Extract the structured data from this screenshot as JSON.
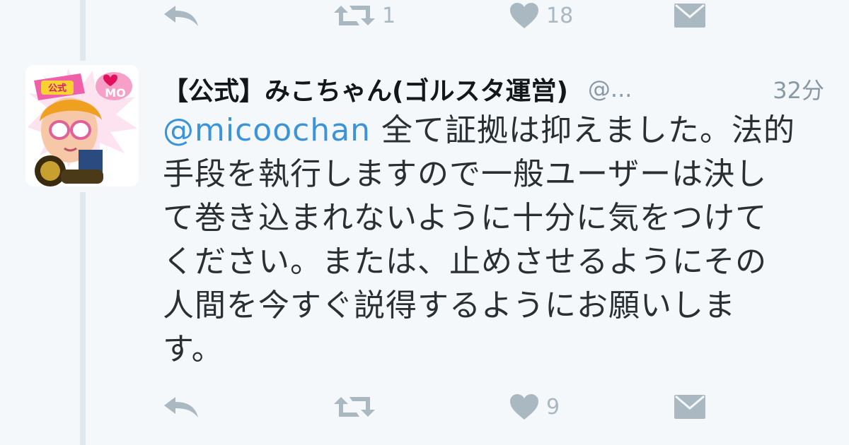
{
  "previous_tweet": {
    "retweet_count": "1",
    "like_count": "18"
  },
  "tweet": {
    "display_name": "【公式】みこちゃん(ゴルスタ運営)",
    "handle": "@...",
    "timestamp": "32分",
    "mention": "@micoochan",
    "text_lines": [
      " 全て証拠は抑えました。法的",
      "手段を執行しますので一般ユーザーは決し",
      "て巻き込まれないように十分に気をつけて",
      "ください。または、止めさせるようにその",
      "人間を今すぐ説得するようにお願いしま",
      "す。"
    ],
    "retweet_count": "",
    "like_count": "9"
  },
  "avatar": {
    "badge_text": "公式",
    "tag_text": "MO"
  },
  "colors": {
    "icon": "#aab8c2",
    "mention": "#3b94d9",
    "background": "#f5f8fa"
  },
  "icons": [
    "reply-icon",
    "retweet-icon",
    "heart-icon",
    "direct-message-icon"
  ]
}
